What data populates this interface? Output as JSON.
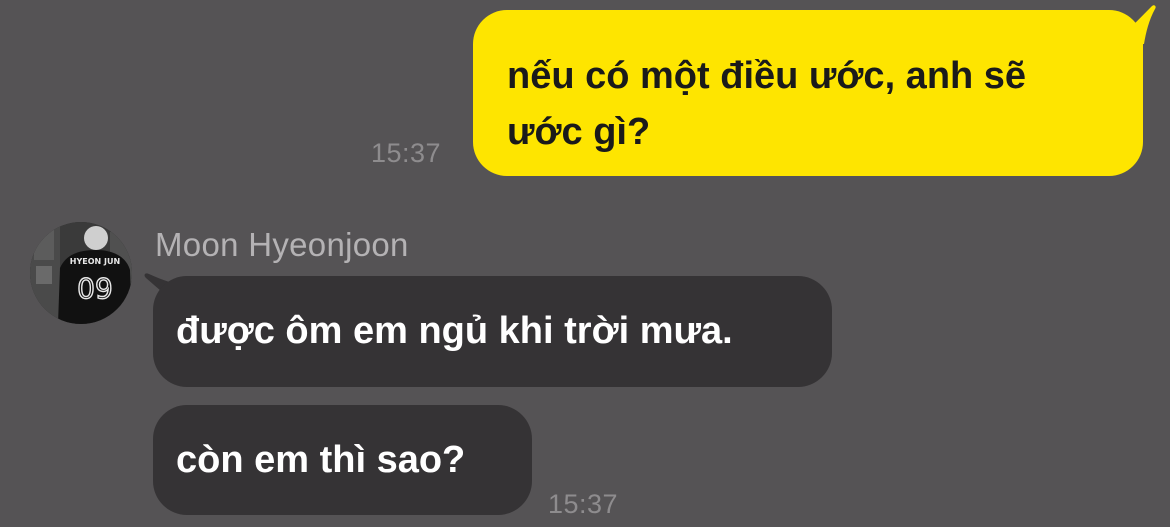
{
  "chat": {
    "outgoing": {
      "text": "nếu có một điều ước, anh sẽ ước gì?",
      "time": "15:37"
    },
    "sender": {
      "name": "Moon Hyeonjoon",
      "avatar_jersey_name": "HYEON JUN",
      "avatar_jersey_number": "09"
    },
    "incoming": [
      {
        "text": "được ôm em ngủ khi trời mưa."
      },
      {
        "text": "còn em thì sao?",
        "time": "15:37"
      }
    ]
  },
  "colors": {
    "background": "#555355",
    "sent_bubble": "#FEE500",
    "received_bubble": "#353335",
    "timestamp": "#8e8c8e",
    "sender_name": "#b4b2b4"
  }
}
